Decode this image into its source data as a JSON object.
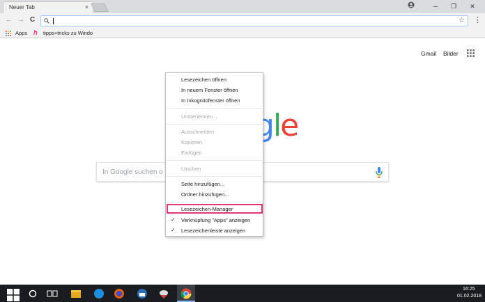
{
  "browser": {
    "tab_title": "Neuer Tab",
    "tab_close": "×",
    "window_controls": {
      "minimize": "─",
      "maximize": "❐",
      "close": "✕",
      "profile": "profile-icon"
    }
  },
  "toolbar": {
    "back": "←",
    "forward": "→",
    "reload": "C",
    "search_icon": "search-icon",
    "star": "☆",
    "menu": "⋮",
    "omnibox_value": ""
  },
  "bookmarks": {
    "apps_label": "Apps",
    "item_label": "tipps+tricks zu Windo"
  },
  "page": {
    "gmail": "Gmail",
    "bilder": "Bilder",
    "search_placeholder": "In Google suchen o",
    "logo_visible": [
      "g",
      "l",
      "e"
    ],
    "logo_colors": [
      "#4285F4",
      "#34A853",
      "#EA4335"
    ]
  },
  "context_menu": {
    "items": [
      {
        "label": "Lesezeichen öffnen",
        "disabled": false
      },
      {
        "label": "In neuem Fenster öffnen",
        "disabled": false
      },
      {
        "label": "In Inkognitofenster öffnen",
        "disabled": false
      },
      {
        "label": "Umbenennen...",
        "disabled": true
      },
      {
        "label": "Ausschneiden",
        "disabled": true
      },
      {
        "label": "Kopieren",
        "disabled": true
      },
      {
        "label": "Einfügen",
        "disabled": true
      },
      {
        "label": "Löschen",
        "disabled": true
      },
      {
        "label": "Seite hinzufügen...",
        "disabled": false
      },
      {
        "label": "Ordner hinzufügen...",
        "disabled": false
      },
      {
        "label": "Lesezeichen-Manager",
        "disabled": false,
        "highlighted": true
      },
      {
        "label": "Verknüpfung \"Apps\" anzeigen",
        "disabled": false,
        "checked": true
      },
      {
        "label": "Lesezeichenleiste anzeigen",
        "disabled": false,
        "checked": true
      }
    ],
    "highlight_color": "#e5337a"
  },
  "taskbar": {
    "time": "16:25",
    "date": "01.02.2018",
    "icons": [
      "windows-start-icon",
      "cortana-icon",
      "task-view-icon",
      "file-explorer-icon",
      "safari-icon",
      "firefox-icon",
      "thunderbird-icon",
      "app-icon",
      "chrome-icon"
    ]
  }
}
